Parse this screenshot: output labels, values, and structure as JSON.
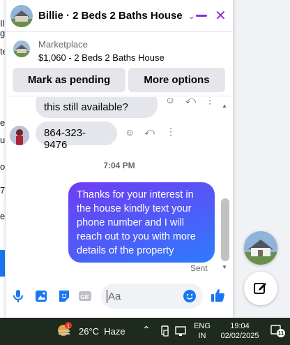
{
  "background": {
    "fragments": [
      "Ilo",
      "g",
      "te",
      "e",
      "u",
      "oe",
      "7",
      "e"
    ]
  },
  "chat": {
    "title": "Billie · 2 Beds 2 Baths House",
    "listing": {
      "source": "Marketplace",
      "title": "$1,060 - 2 Beds 2 Baths House"
    },
    "buttons": {
      "mark_pending": "Mark as pending",
      "more_options": "More options"
    },
    "messages": {
      "incoming_partial": "this still available?",
      "incoming_phone": "864-323-9476",
      "timestamp": "7:04 PM",
      "outgoing": "Thanks for your interest in the house kindly text your phone number and I will reach out to you with more details of the property",
      "status": "Sent"
    },
    "composer": {
      "placeholder": "Aa",
      "icons": [
        "microphone-icon",
        "photo-icon",
        "sticker-icon",
        "gif-icon",
        "emoji-icon",
        "like-icon"
      ]
    },
    "accent_color": "#8a2be2",
    "bubble_gradient": [
      "#6e3df3",
      "#2d7cff"
    ]
  },
  "taskbar": {
    "weather_badge": "1",
    "temperature": "26°C",
    "condition": "Haze",
    "language": [
      "ENG",
      "IN"
    ],
    "time": "19:04",
    "date": "02/02/2025",
    "notifications": "11"
  }
}
